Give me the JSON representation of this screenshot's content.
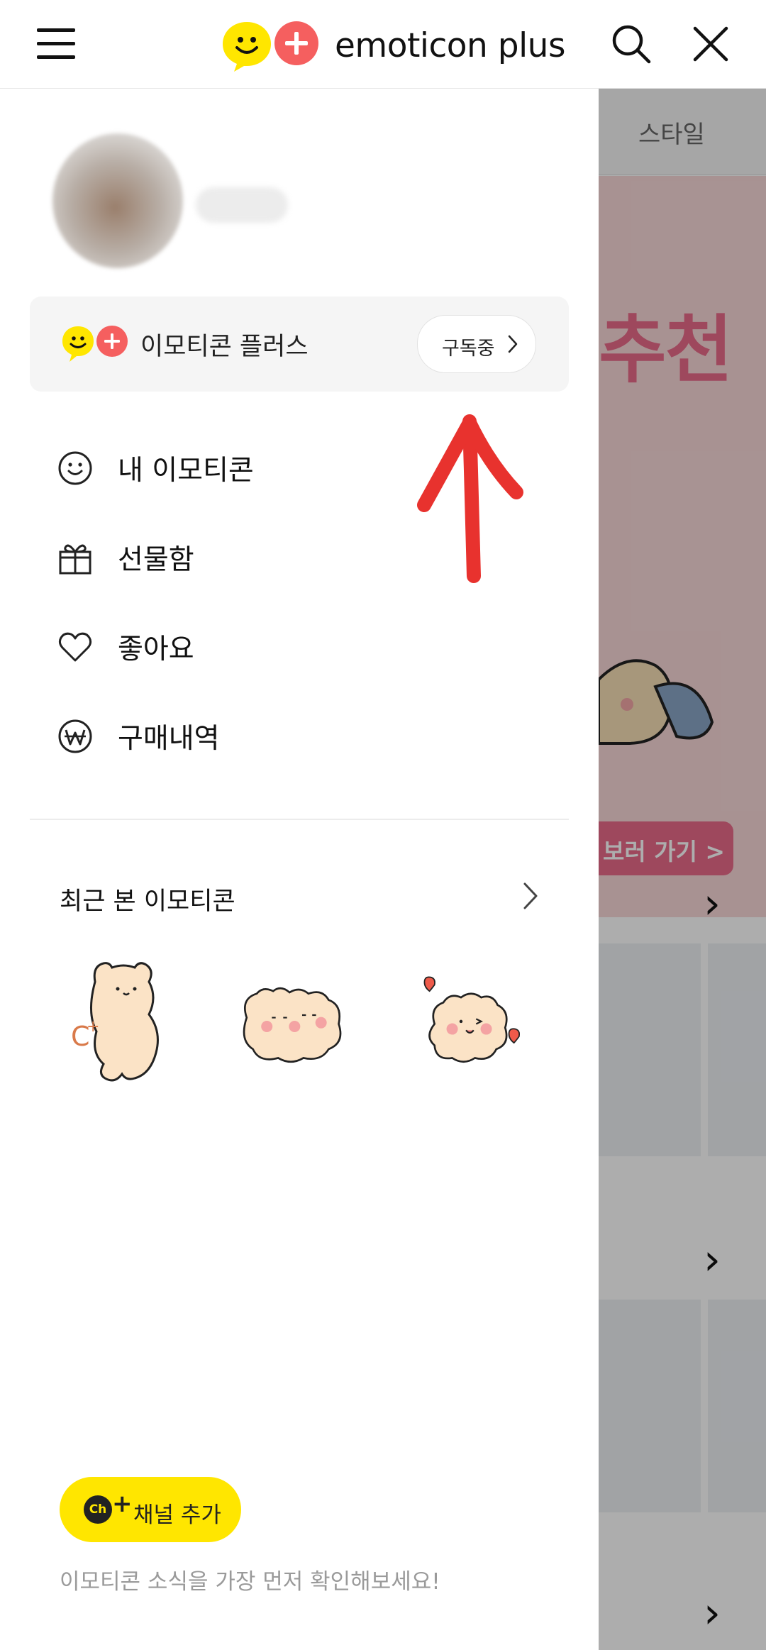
{
  "header": {
    "brand_text": "emoticon plus",
    "menu_icon": "hamburger-menu-icon",
    "search_icon": "search-icon",
    "close_icon": "close-icon"
  },
  "drawer": {
    "plus_card": {
      "label": "이모티콘 플러스",
      "subscribe_label": "구독중"
    },
    "menu": [
      {
        "label": "내 이모티콘",
        "icon": "smiley-icon"
      },
      {
        "label": "선물함",
        "icon": "gift-icon"
      },
      {
        "label": "좋아요",
        "icon": "heart-icon"
      },
      {
        "label": "구매내역",
        "icon": "won-icon"
      }
    ],
    "recent": {
      "title": "최근 본 이모티콘",
      "items": [
        "bear-sticker-1",
        "bear-sticker-2",
        "bear-sticker-3"
      ]
    },
    "channel_button": {
      "badge": "Ch",
      "label": "채널 추가"
    },
    "footer_note": "이모티콘 소식을 가장 먼저 확인해보세요!"
  },
  "background": {
    "tab_label": "스타일",
    "banner_title": "추천",
    "banner_button": "보러 가기 >"
  },
  "colors": {
    "brand_yellow": "#ffe600",
    "brand_red": "#f55f5f",
    "annotation_red": "#e8322e"
  }
}
